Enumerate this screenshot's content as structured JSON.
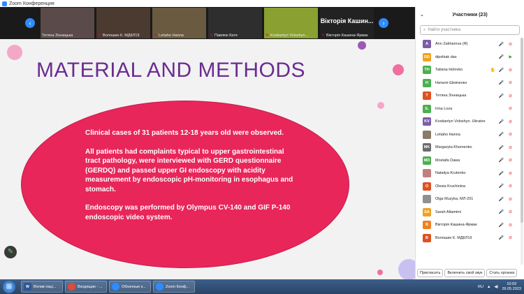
{
  "window": {
    "title": "Zoom Конференция"
  },
  "thumbnails": [
    {
      "name": "Тетяна Зінницька",
      "muted": false,
      "bg": "#5a4a4a"
    },
    {
      "name": "Волошин К. МДКЛ19",
      "muted": true,
      "bg": "#4a3a30"
    },
    {
      "name": "Letiaho Hanna",
      "muted": true,
      "bg": "#6a5a40"
    },
    {
      "name": "Павлюк Катя",
      "muted": true,
      "bg": "#2e2e2e"
    },
    {
      "name": "Kostiantyn Voloshyn...",
      "muted": true,
      "bg": "#8aa030"
    },
    {
      "name": "Вікторія Кашина-Ярмак",
      "muted": true,
      "bg": "#222222",
      "display_name": "Вікторія Кашин..."
    }
  ],
  "nav": {
    "prev": "‹",
    "next": "›"
  },
  "slide": {
    "title": "MATERIAL AND METHODS",
    "paragraphs": [
      "Clinical cases of 31 patients 12-18 years old were observed.",
      "All patients had complaints typical to upper gastrointestinal tract pathology, were interviewed with GERD questionnaire (GERDQ) and passed upper GI endoscopy with acidity measurement by endoscopic pH-monitoring in esophagus and stomach.",
      "Endoscopy was performed by Olympus CV-140 and GIF P-140 endoscopic video system."
    ],
    "title_color": "#6a2c91",
    "ellipse_color": "#e8265a"
  },
  "participants": {
    "header": "Участники (23)",
    "search_placeholder": "Найти участника",
    "items": [
      {
        "initials": "A",
        "name": "Ann Zakharova (Я)",
        "color": "#7b5ea7",
        "icons": "mic-off video-off"
      },
      {
        "initials": "DD",
        "name": "dipshiak das",
        "color": "#f0a020",
        "icons": "video-on mic-on"
      },
      {
        "initials": "TH",
        "name": "Tatiana Holovko",
        "color": "#4caf50",
        "icons": "hand mic-off video-off"
      },
      {
        "initials": "Н",
        "name": "Наталя Шевченко",
        "color": "#4caf50",
        "icons": "mic-on video-off"
      },
      {
        "initials": "Т",
        "name": "Тетяна Зінницька",
        "color": "#e05020",
        "icons": "mic-on video-off"
      },
      {
        "initials": "IL",
        "name": "Irina Loza",
        "color": "#4caf50",
        "icons": "video-off"
      },
      {
        "initials": "KV",
        "name": "Kostiantyn Voloshyn. Ukraine",
        "color": "#7b5ea7",
        "icons": "mic-off video-off"
      },
      {
        "initials": "",
        "name": "Letiaho Hanna",
        "color": "#8a7a6a",
        "icons": "mic-off video-off"
      },
      {
        "initials": "MK",
        "name": "Margaryta Khomenko",
        "color": "#6a6a6a",
        "icons": "mic-off video-off"
      },
      {
        "initials": "MD",
        "name": "Mostafa Dawa",
        "color": "#4caf50",
        "icons": "mic-off video-off"
      },
      {
        "initials": "",
        "name": "Nataliya Krutenko",
        "color": "#c08080",
        "icons": "mic-off video-off"
      },
      {
        "initials": "O",
        "name": "Olesia Kruchinina",
        "color": "#e05020",
        "icons": "mic-off video-off"
      },
      {
        "initials": "",
        "name": "Olga Muzyka, МЛ-201",
        "color": "#909090",
        "icons": "mic-off video-off"
      },
      {
        "initials": "SA",
        "name": "Sarah Altamimi",
        "color": "#f0a020",
        "icons": "mic-off video-off"
      },
      {
        "initials": "В",
        "name": "Вікторія Кашина-Ярмак",
        "color": "#f08020",
        "icons": "mic-off video-off"
      },
      {
        "initials": "В",
        "name": "Волошин К. МДКЛ19",
        "color": "#e05020",
        "icons": "mic-off video-off"
      }
    ],
    "footer": {
      "invite": "Пригласить",
      "unmute": "Включить свой звук",
      "more": "Стать организ"
    }
  },
  "taskbar": {
    "start_icon": "windows-start-icon",
    "items": [
      {
        "label": "Вплив паці...",
        "icon": "W",
        "color": "#2b5797"
      },
      {
        "label": "Входящие - ...",
        "icon": "●",
        "color": "#dd4b39"
      },
      {
        "label": "Облачные к...",
        "icon": "zoom",
        "color": "#2d8cff"
      },
      {
        "label": "Zoom Конф...",
        "icon": "zoom",
        "color": "#2d8cff"
      }
    ],
    "lang": "RU",
    "time": "10:03",
    "date": "26.05.2023"
  }
}
